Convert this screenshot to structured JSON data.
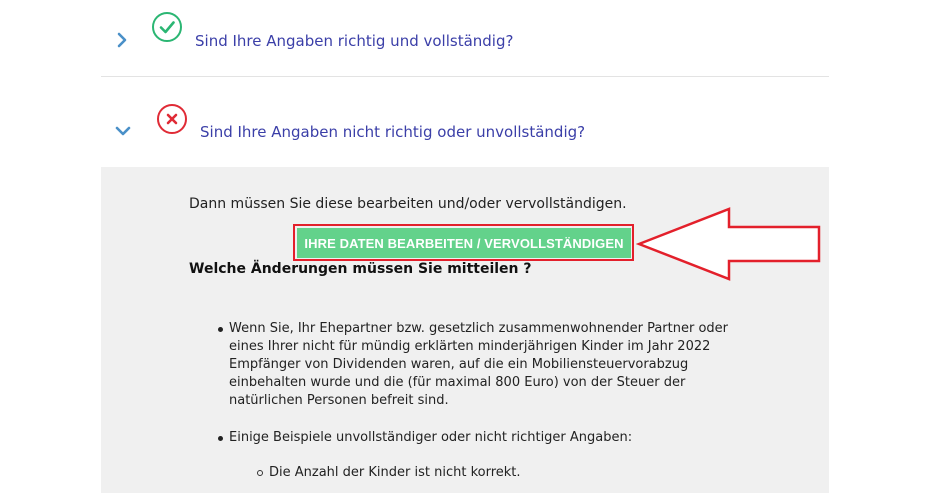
{
  "accordion": {
    "items": [
      {
        "title": "Sind Ihre Angaben richtig und vollständig?",
        "status_icon": "check-circle-icon",
        "expanded": false
      },
      {
        "title": "Sind Ihre Angaben nicht richtig oder unvollständig?",
        "status_icon": "x-circle-icon",
        "expanded": true
      }
    ]
  },
  "panel": {
    "intro": "Dann müssen Sie diese bearbeiten und/oder vervollständigen.",
    "action_button": "IHRE DATEN BEARBEITEN / VERVOLLSTÄNDIGEN",
    "heading": "Welche Änderungen müssen Sie mitteilen ?",
    "bullets": [
      "Wenn Sie, Ihr Ehepartner bzw. gesetzlich zusammenwohnender Partner oder eines Ihrer nicht für mündig erklärten minderjährigen Kinder im Jahr 2022 Empfänger von Dividenden waren, auf die ein Mobiliensteuervorabzug einbehalten wurde und die (für maximal 800 Euro) von der Steuer der natürlichen Personen befreit sind.",
      "Einige Beispiele unvollständiger oder nicht richtiger Angaben:"
    ],
    "sub_bullets": [
      "Die Anzahl der Kinder ist nicht korrekt."
    ]
  },
  "colors": {
    "link_text": "#3b3fa8",
    "chevron": "#4a90c8",
    "check": "#2bb673",
    "error": "#e02b36",
    "button_bg": "#63d28b",
    "panel_bg": "#f0f0f0",
    "annotation": "#e3202b"
  }
}
